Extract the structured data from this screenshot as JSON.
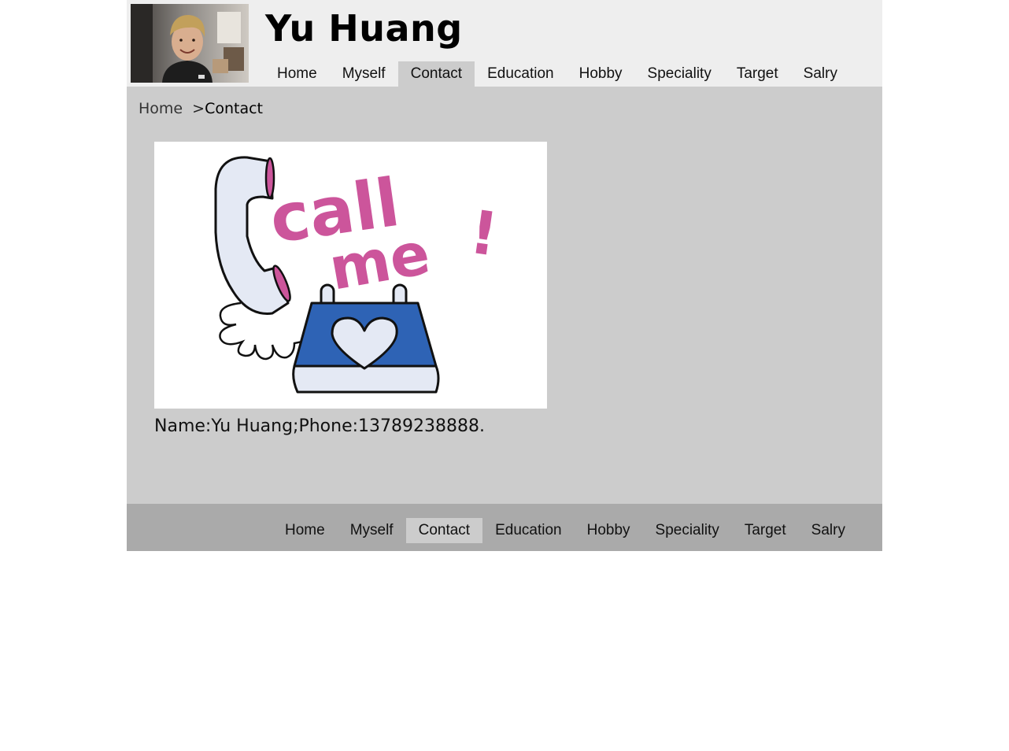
{
  "header": {
    "site_title": "Yu Huang",
    "avatar_icon": "profile-photo"
  },
  "nav": {
    "items": [
      {
        "label": "Home"
      },
      {
        "label": "Myself"
      },
      {
        "label": "Contact",
        "active": true
      },
      {
        "label": "Education"
      },
      {
        "label": "Hobby"
      },
      {
        "label": "Speciality"
      },
      {
        "label": "Target"
      },
      {
        "label": "Salry"
      }
    ]
  },
  "breadcrumb": {
    "home": "Home",
    "separator": ">",
    "current": "Contact"
  },
  "contact": {
    "image_text_line1": "call",
    "image_text_line2": "me",
    "image_text_excl": "!",
    "info": "Name:Yu Huang;Phone:13789238888."
  },
  "colors": {
    "header_bg": "#eeeeee",
    "content_bg": "#cccccc",
    "footer_bg": "#aaaaaa",
    "active_tab_bg": "#cccccc",
    "call_me_pink": "#cc559b",
    "phone_blue": "#2e63b5"
  }
}
